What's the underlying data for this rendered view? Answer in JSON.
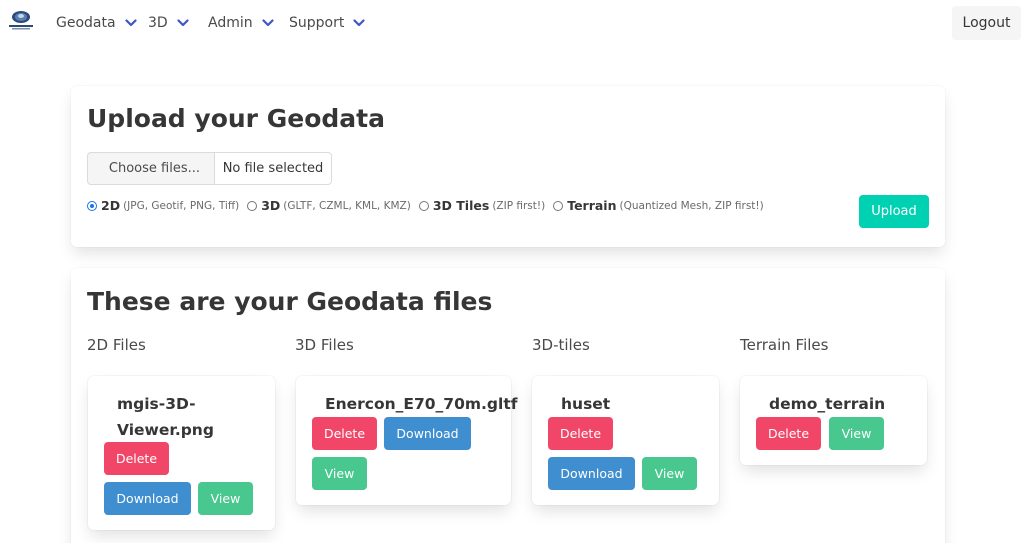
{
  "nav": {
    "items": [
      {
        "label": "Geodata"
      },
      {
        "label": "3D"
      },
      {
        "label": "Admin"
      },
      {
        "label": "Support"
      }
    ],
    "logout_label": "Logout"
  },
  "upload": {
    "title": "Upload your Geodata",
    "choose_label": "Choose files...",
    "file_name": "No file selected",
    "radios": [
      {
        "label": "2D",
        "hint": "(JPG, Geotif, PNG, Tiff)",
        "checked": true
      },
      {
        "label": "3D",
        "hint": "(GLTF, CZML, KML, KMZ)",
        "checked": false
      },
      {
        "label": "3D Tiles",
        "hint": "(ZIP first!)",
        "checked": false
      },
      {
        "label": "Terrain",
        "hint": "(Quantized Mesh, ZIP first!)",
        "checked": false
      }
    ],
    "upload_label": "Upload"
  },
  "files": {
    "title": "These are your Geodata files",
    "columns": [
      {
        "heading": "2D Files",
        "file": "mgis-3D-Viewer.png"
      },
      {
        "heading": "3D Files",
        "file": "Enercon_E70_70m.gltf"
      },
      {
        "heading": "3D-tiles",
        "file": "huset"
      },
      {
        "heading": "Terrain Files",
        "file": "demo_terrain"
      }
    ],
    "delete_label": "Delete",
    "download_label": "Download",
    "view_label": "View",
    "name_line1": "mgis-3D-",
    "name_line2": "Viewer.png"
  },
  "colors": {
    "upload": "#00d1b2",
    "delete": "#f14668",
    "download": "#3e8ed0",
    "view": "#48c78e",
    "nav_chevron": "#3e56c8"
  },
  "icons": [
    "logo-icon",
    "chevron-down-icon"
  ]
}
